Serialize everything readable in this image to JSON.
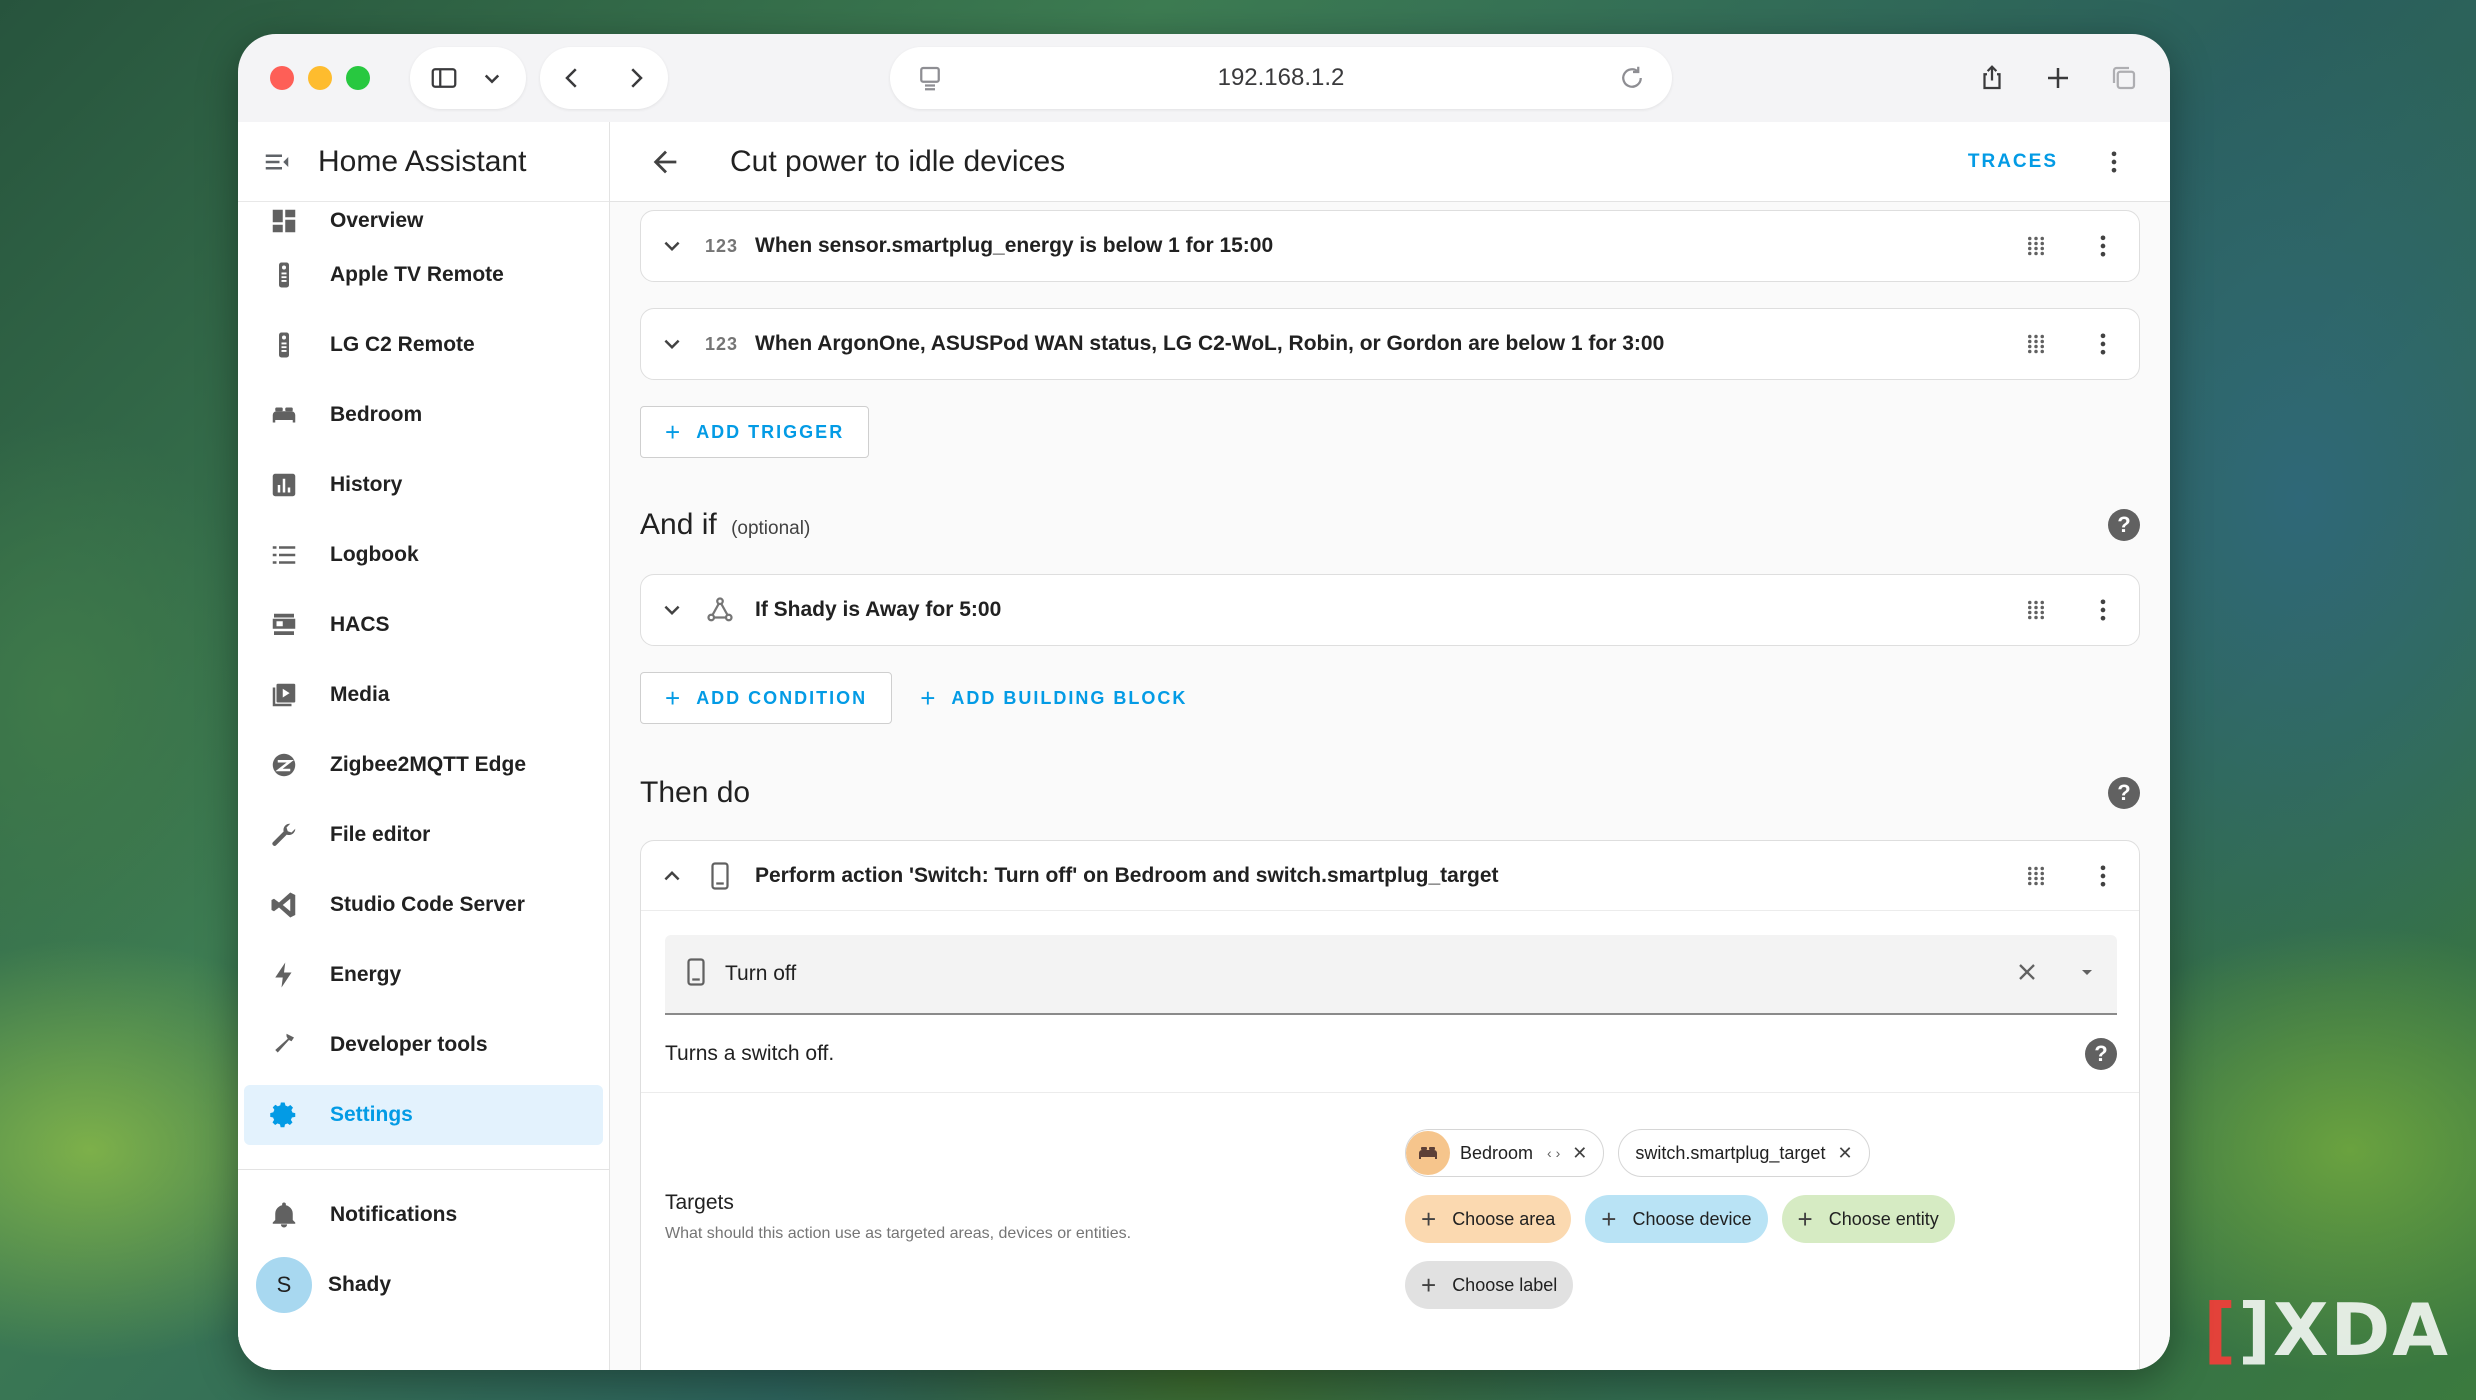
{
  "browser": {
    "address": "192.168.1.2"
  },
  "sidebar": {
    "title": "Home Assistant",
    "items": [
      {
        "label": "Overview",
        "icon": "overview-icon"
      },
      {
        "label": "Apple TV Remote",
        "icon": "remote-icon"
      },
      {
        "label": "LG C2 Remote",
        "icon": "remote-icon"
      },
      {
        "label": "Bedroom",
        "icon": "bed-icon"
      },
      {
        "label": "History",
        "icon": "chart-icon"
      },
      {
        "label": "Logbook",
        "icon": "list-icon"
      },
      {
        "label": "HACS",
        "icon": "hacs-icon"
      },
      {
        "label": "Media",
        "icon": "media-icon"
      },
      {
        "label": "Zigbee2MQTT Edge",
        "icon": "zigbee-icon"
      },
      {
        "label": "File editor",
        "icon": "wrench-icon"
      },
      {
        "label": "Studio Code Server",
        "icon": "vscode-icon"
      },
      {
        "label": "Energy",
        "icon": "lightning-icon"
      },
      {
        "label": "Developer tools",
        "icon": "hammer-icon"
      },
      {
        "label": "Settings",
        "icon": "gear-icon"
      }
    ],
    "notifications_label": "Notifications",
    "user_initial": "S",
    "user_name": "Shady"
  },
  "header": {
    "title": "Cut power to idle devices",
    "traces_label": "TRACES"
  },
  "triggers": [
    {
      "icon_text": "123",
      "text": "When sensor.smartplug_energy is below 1 for 15:00"
    },
    {
      "icon_text": "123",
      "text": "When ArgonOne, ASUSPod WAN status, LG C2-WoL, Robin, or Gordon are below 1 for 3:00"
    }
  ],
  "add_trigger_label": "ADD TRIGGER",
  "conditions_section": {
    "title": "And if",
    "optional": "(optional)",
    "items": [
      {
        "text": "If Shady is Away for 5:00"
      }
    ],
    "add_condition_label": "ADD CONDITION",
    "add_block_label": "ADD BUILDING BLOCK"
  },
  "actions_section": {
    "title": "Then do",
    "action_text": "Perform action 'Switch: Turn off' on Bedroom and switch.smartplug_target",
    "selected_action": "Turn off",
    "description": "Turns a switch off.",
    "targets_label": "Targets",
    "targets_hint": "What should this action use as targeted areas, devices or entities.",
    "target_chips": [
      {
        "label": "Bedroom"
      },
      {
        "label": "switch.smartplug_target"
      }
    ],
    "choose_area": "Choose area",
    "choose_device": "Choose device",
    "choose_entity": "Choose entity",
    "choose_label": "Choose label"
  },
  "colors": {
    "accent": "#039be5",
    "active_bg": "#e3f2fd"
  }
}
